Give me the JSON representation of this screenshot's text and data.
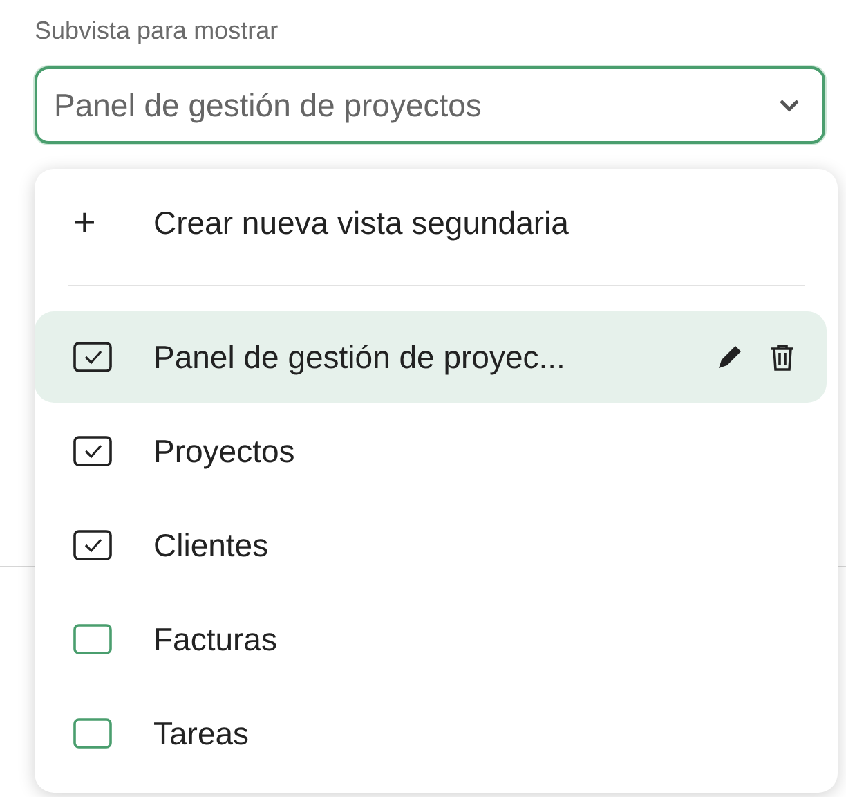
{
  "field": {
    "label": "Subvista para mostrar",
    "value": "Panel de gestión de proyectos",
    "expanded": true
  },
  "menu": {
    "create": {
      "icon": "+",
      "label": "Crear nueva vista segundaria"
    },
    "items": [
      {
        "label": "Panel de gestión de proyec...",
        "checked": true,
        "selected": true
      },
      {
        "label": "Proyectos",
        "checked": true,
        "selected": false
      },
      {
        "label": "Clientes",
        "checked": true,
        "selected": false
      },
      {
        "label": "Facturas",
        "checked": false,
        "selected": false
      },
      {
        "label": "Tareas",
        "checked": false,
        "selected": false
      }
    ]
  }
}
